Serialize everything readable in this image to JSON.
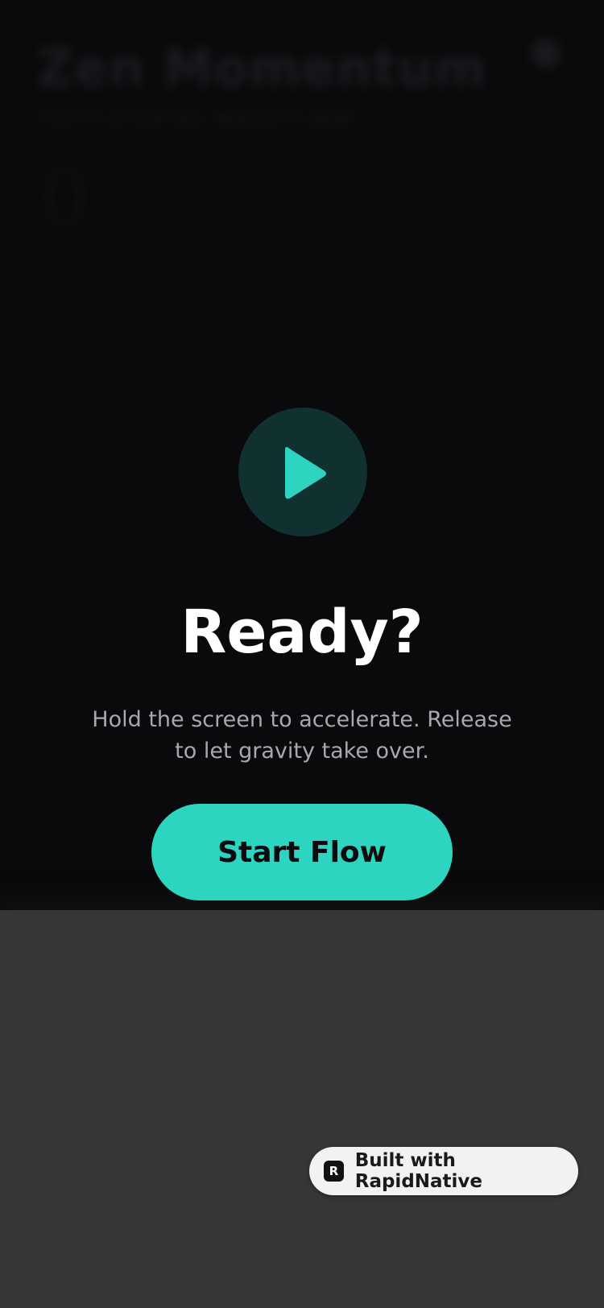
{
  "background": {
    "title": "Zen Momentum",
    "subtitle": "Hold to accelerate. Release to glide.",
    "score": "0"
  },
  "overlay": {
    "icon": "play-icon",
    "title": "Ready?",
    "description": "Hold the screen to accelerate. Release to let gravity take over.",
    "start_label": "Start Flow"
  },
  "badge": {
    "logo": "R",
    "label": "Built with RapidNative"
  },
  "colors": {
    "accent": "#2dd4bf",
    "background": "#0a0a0c",
    "panel": "#363638",
    "play_circle": "#103130"
  }
}
